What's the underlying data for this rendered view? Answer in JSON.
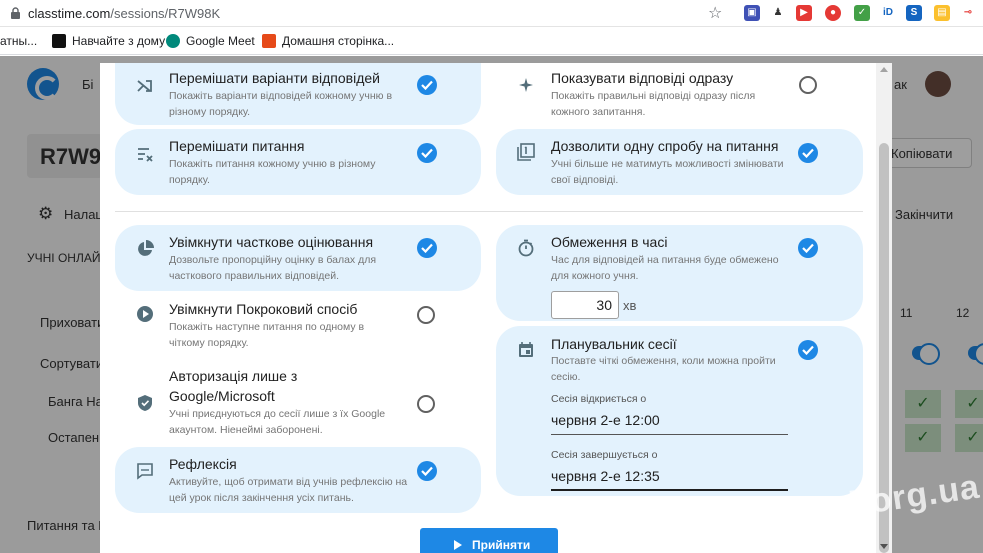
{
  "browser": {
    "url_host": "classtime.com",
    "url_path": "/sessions/R7W98K",
    "bookmarks": [
      {
        "label": "атны..."
      },
      {
        "label": "Навчайте з дому"
      },
      {
        "label": "Google Meet"
      },
      {
        "label": "Домашня сторінка..."
      }
    ]
  },
  "background": {
    "brand_fragment": "Бі",
    "session_code": "R7W9",
    "user_fragment": "ак",
    "copy_label": "Копіювати",
    "settings_fragment": "Налаш",
    "finish_label": "Закінчити",
    "students_online_fragment": "УЧНІ ОНЛАЙ",
    "hide_fragment": "Приховати",
    "sort_fragment": "Сортувати",
    "student1_fragment": "Банга На",
    "student2_fragment": "Остапенк",
    "footer_fragment": "Питання та В",
    "col11": "11",
    "col12": "12"
  },
  "options": {
    "shuffle_answers": {
      "title": "Перемішати варіанти відповідей",
      "desc": "Покажіть варіанти відповідей кожному учню в різному порядку.",
      "checked": true
    },
    "show_answers": {
      "title": "Показувати відповіді одразу",
      "desc": "Покажіть правильні відповіді одразу після кожного запитання.",
      "checked": false
    },
    "shuffle_questions": {
      "title": "Перемішати питання",
      "desc": "Покажіть питання кожному учню в різному порядку.",
      "checked": true
    },
    "one_attempt": {
      "title": "Дозволити одну спробу на питання",
      "desc": "Учні більше не матимуть можливості змінювати свої відповіді.",
      "checked": true
    },
    "partial_grading": {
      "title": "Увімкнути часткове оцінювання",
      "desc": "Дозвольте пропорційну оцінку в балах для часткового правильних відповідей.",
      "checked": true
    },
    "time_limit": {
      "title": "Обмеження в часі",
      "desc": "Час для відповідей на питання буде обмежено для кожного учня.",
      "checked": true,
      "minutes": "30",
      "unit": "хв"
    },
    "step_by_step": {
      "title": "Увімкнути Покроковий спосіб",
      "desc": "Покажіть наступне питання по одному в чіткому порядку.",
      "checked": false
    },
    "google_auth": {
      "title_line1": "Авторизація лише з",
      "title_line2": "Google/Microsoft",
      "desc": "Учні приєднуються до сесії лише з їх Google акаунтом. Ніенеймі заборонені.",
      "checked": false
    },
    "scheduler": {
      "title": "Планувальник сесії",
      "desc": "Поставте чіткі обмеження, коли можна пройти сесію.",
      "checked": true,
      "opens_label": "Сесія відкриється о",
      "opens_value": "червня 2-е 12:00",
      "closes_label": "Сесія завершується о",
      "closes_value": "червня 2-е 12:35"
    },
    "reflection": {
      "title": "Рефлексія",
      "desc": "Активуйте, щоб отримати від учнів рефлексію на цей урок після закінчення усіх питань.",
      "checked": true
    }
  },
  "accept_label": "Прийняти",
  "watermark": "mahorg.ua",
  "colors": {
    "accent": "#1e88e5",
    "card_bg": "#e3f2fd"
  }
}
